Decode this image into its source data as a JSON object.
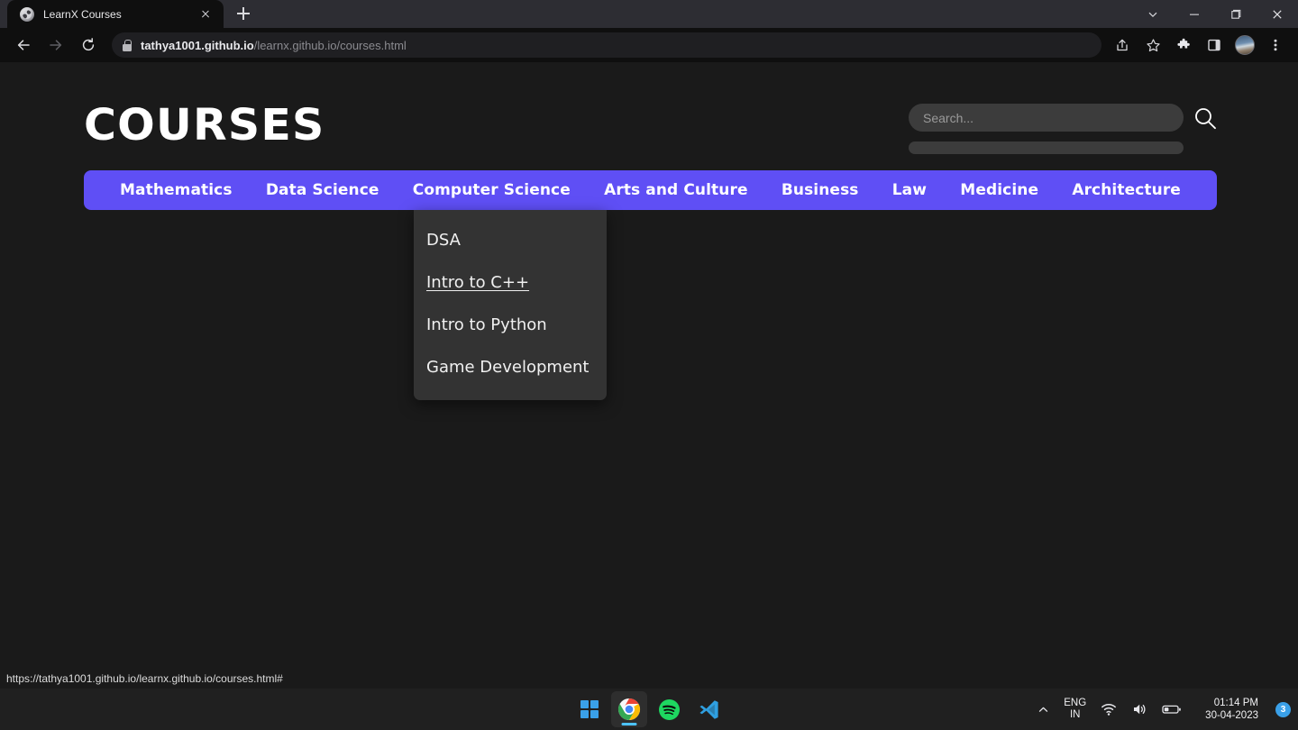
{
  "browser": {
    "tab": {
      "title": "LearnX Courses",
      "favicon": "globe-icon"
    },
    "new_tab_label": "+",
    "address": {
      "host": "tathya1001.github.io",
      "path": "/learnx.github.io/courses.html"
    },
    "toolbar_icons": [
      "share-icon",
      "bookmark-star-icon",
      "extensions-puzzle-icon",
      "side-panel-icon",
      "profile-avatar",
      "three-dot-menu-icon"
    ],
    "window_controls": [
      "tab-search-chevron",
      "minimize",
      "maximize",
      "close"
    ]
  },
  "page": {
    "title": "COURSES",
    "search": {
      "placeholder": "Search...",
      "value": "",
      "icon": "magnifier-icon"
    },
    "nav": {
      "accent_color": "#5f4ff5",
      "items": [
        {
          "label": "Mathematics"
        },
        {
          "label": "Data Science"
        },
        {
          "label": "Computer Science"
        },
        {
          "label": "Arts and Culture"
        },
        {
          "label": "Business"
        },
        {
          "label": "Law"
        },
        {
          "label": "Medicine"
        },
        {
          "label": "Architecture"
        }
      ]
    },
    "dropdown": {
      "parent": "Computer Science",
      "items": [
        {
          "label": "DSA",
          "hovered": false
        },
        {
          "label": "Intro to C++",
          "hovered": true
        },
        {
          "label": "Intro to Python",
          "hovered": false
        },
        {
          "label": "Game Development",
          "hovered": false
        }
      ]
    },
    "status_link": "https://tathya1001.github.io/learnx.github.io/courses.html#",
    "background_color": "#1a1a1a"
  },
  "taskbar": {
    "apps": [
      "windows-start-icon",
      "chrome-icon",
      "spotify-icon",
      "vscode-icon"
    ],
    "tray": {
      "overflow": "chevron-up-icon",
      "language": {
        "line1": "ENG",
        "line2": "IN"
      },
      "icons": [
        "wifi-icon",
        "volume-icon",
        "battery-icon"
      ],
      "time": "01:14 PM",
      "date": "30-04-2023",
      "notification_count": "3"
    }
  }
}
